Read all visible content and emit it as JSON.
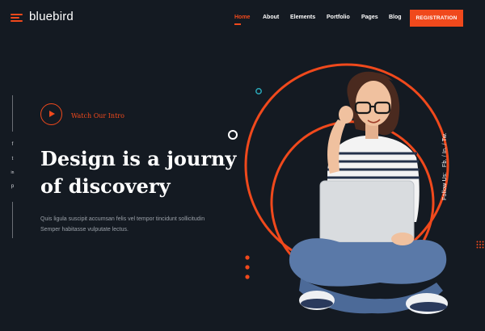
{
  "header": {
    "logo": "bluebird",
    "nav": [
      "Home",
      "About",
      "Elements",
      "Portfolio",
      "Pages",
      "Blog"
    ],
    "active": "Home",
    "cta": "REGISTRATION"
  },
  "social_rail": [
    "f",
    "t",
    "in",
    "p"
  ],
  "hero": {
    "watch_label": "Watch Our Intro",
    "headline_line1": "Design is a journy",
    "headline_line2": "of discovery",
    "description_line1": "Quis ligula suscipit accumsan felis vel tempor tincidunt sollicitudin",
    "description_line2": "Semper habitasse vulputate lectus."
  },
  "follow": {
    "label": "Follow Us:",
    "links": [
      "Fb.",
      "In.",
      "Tw."
    ]
  },
  "colors": {
    "background": "#141a22",
    "accent": "#f0491c",
    "teal_ring": "#2aa7b8"
  }
}
